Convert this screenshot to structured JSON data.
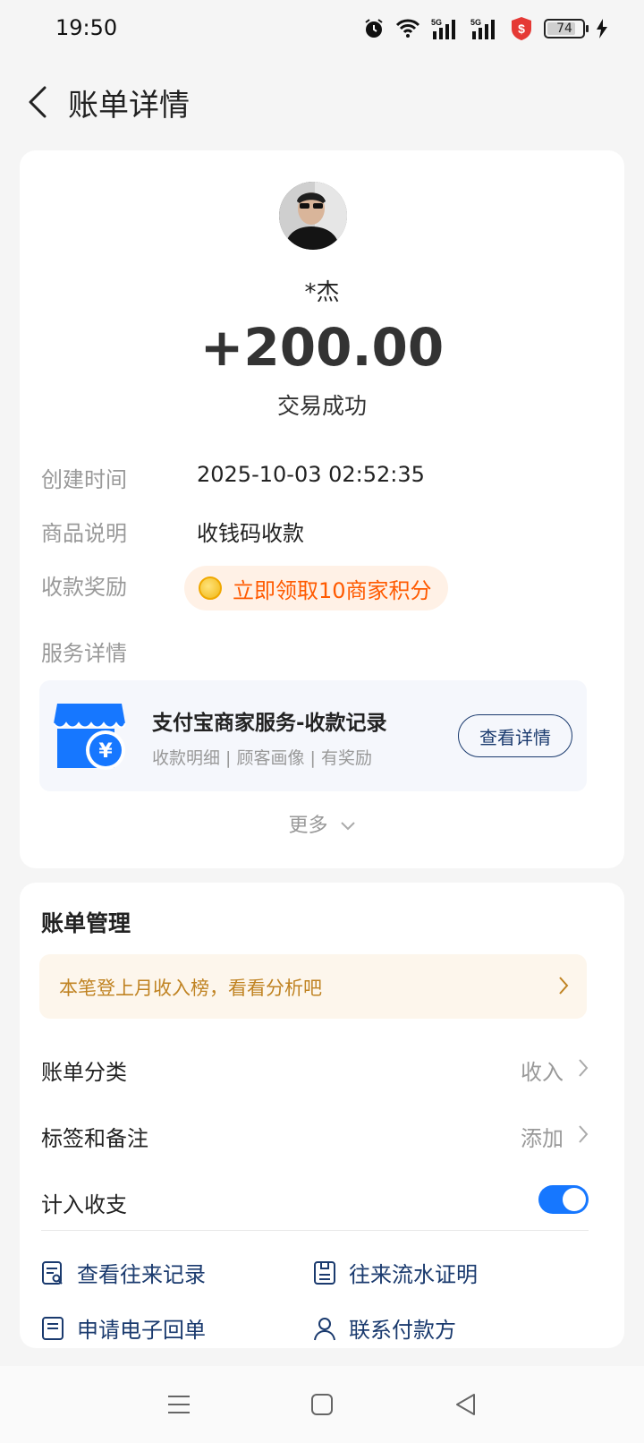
{
  "status_bar": {
    "time": "19:50",
    "battery": "74"
  },
  "header": {
    "title": "账单详情"
  },
  "bill": {
    "payer_name": "*杰",
    "amount": "+200.00",
    "status": "交易成功",
    "created_label": "创建时间",
    "created_value": "2025-10-03 02:52:35",
    "product_label": "商品说明",
    "product_value": "收钱码收款",
    "reward_label": "收款奖励",
    "reward_text": "立即领取10商家积分",
    "service_label": "服务详情",
    "service": {
      "title": "支付宝商家服务-收款记录",
      "subtitle": "收款明细 | 顾客画像 | 有奖励",
      "button": "查看详情"
    },
    "more_label": "更多"
  },
  "management": {
    "title": "账单管理",
    "promo_text": "本笔登上月收入榜，看看分析吧",
    "category_label": "账单分类",
    "category_value": "收入",
    "tags_label": "标签和备注",
    "tags_value": "添加",
    "count_label": "计入收支",
    "count_enabled": true,
    "actions": [
      {
        "label": "查看往来记录",
        "icon": "record-search-icon"
      },
      {
        "label": "往来流水证明",
        "icon": "statement-icon"
      },
      {
        "label": "申请电子回单",
        "icon": "receipt-icon"
      },
      {
        "label": "联系付款方",
        "icon": "contact-icon"
      }
    ]
  },
  "colors": {
    "accent": "#1677ff",
    "navy": "#1a3a6e",
    "orange": "#ff5a00",
    "promo_text": "#c08322"
  }
}
